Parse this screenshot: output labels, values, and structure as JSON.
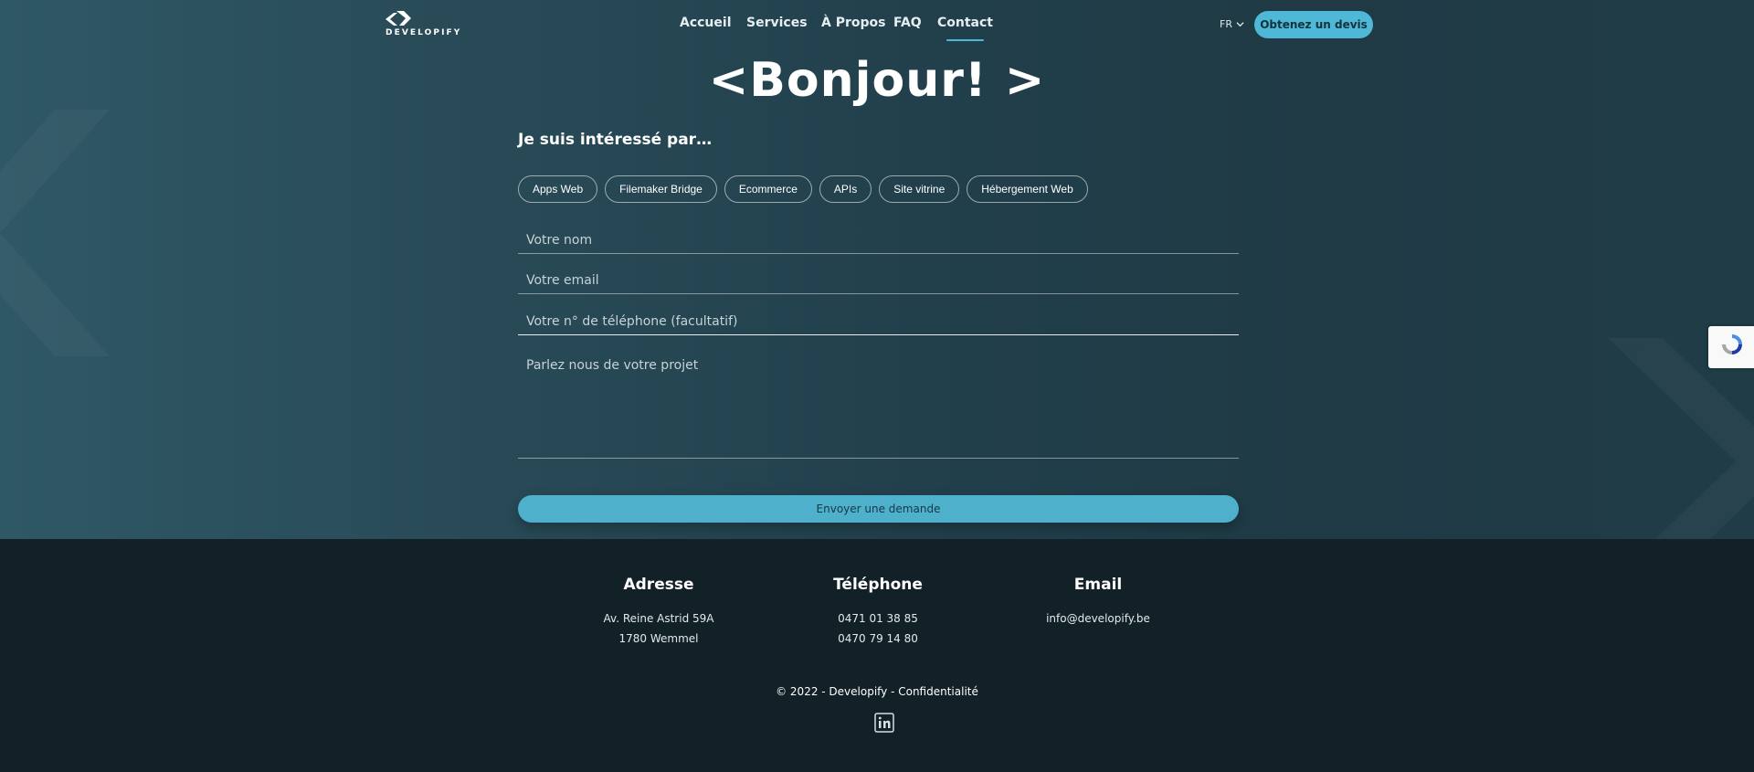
{
  "brand": {
    "logo_text": "DEVELOPIFY"
  },
  "nav": {
    "items": [
      {
        "label": "Accueil"
      },
      {
        "label": "Services"
      },
      {
        "label": "À Propos"
      },
      {
        "label": "FAQ"
      },
      {
        "label": "Contact",
        "active": true
      }
    ],
    "language": "FR",
    "cta_label": "Obtenez un devis"
  },
  "hero": {
    "headline": "<Bonjour!  >",
    "subhead": "Je suis intéressé par…",
    "chips": [
      "Apps Web",
      "Filemaker Bridge",
      "Ecommerce",
      "APIs",
      "Site vitrine",
      "Hébergement Web"
    ]
  },
  "form": {
    "name_placeholder": "Votre nom",
    "email_placeholder": "Votre email",
    "phone_placeholder": "Votre n° de téléphone (facultatif)",
    "message_placeholder": "Parlez nous de votre projet",
    "submit_label": "Envoyer une demande"
  },
  "footer": {
    "address": {
      "title": "Adresse",
      "lines": [
        "Av. Reine Astrid 59A",
        "1780 Wemmel"
      ]
    },
    "phone": {
      "title": "Téléphone",
      "lines": [
        "0471 01 38 85",
        "0470 79 14 80"
      ]
    },
    "email": {
      "title": "Email",
      "lines": [
        "info@developify.be"
      ]
    },
    "copyright": "© 2022 - Developify - Confidentialité"
  },
  "colors": {
    "accent": "#4fb8d6",
    "footer_bg": "#122027",
    "hero_bg": "#26485a"
  },
  "icons": [
    "developify-logo-icon",
    "chevron-down-icon",
    "recaptcha-icon",
    "linkedin-icon"
  ]
}
